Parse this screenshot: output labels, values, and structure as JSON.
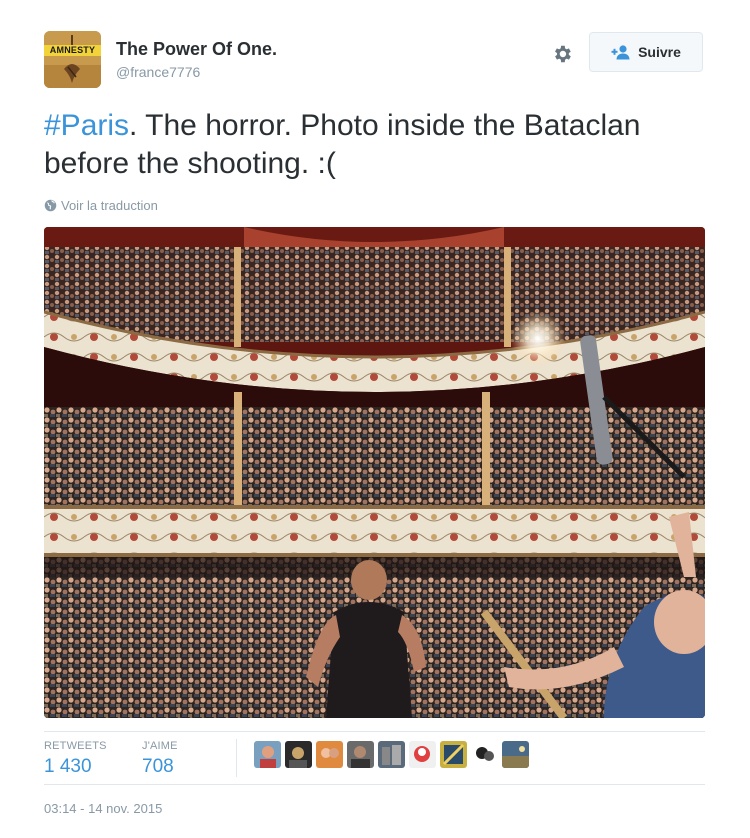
{
  "author": {
    "avatar_text": "AMNESTY",
    "display_name": "The Power Of One.",
    "handle": "@france7776"
  },
  "actions": {
    "settings_icon": "gear-icon",
    "follow_label": "Suivre",
    "follow_icon": "add-person-icon"
  },
  "tweet": {
    "hashtag": "#Paris",
    "text": ". The horror. Photo inside the Bataclan before the shooting. :(",
    "translate_label": "Voir la traduction"
  },
  "stats": {
    "retweets_label": "RETWEETS",
    "retweets_value": "1 430",
    "likes_label": "J'AIME",
    "likes_value": "708"
  },
  "timestamp": "03:14 - 14 nov. 2015",
  "colors": {
    "link": "#3b94d9",
    "text": "#292f33",
    "muted": "#8899a6",
    "border": "#e1e8ed"
  }
}
